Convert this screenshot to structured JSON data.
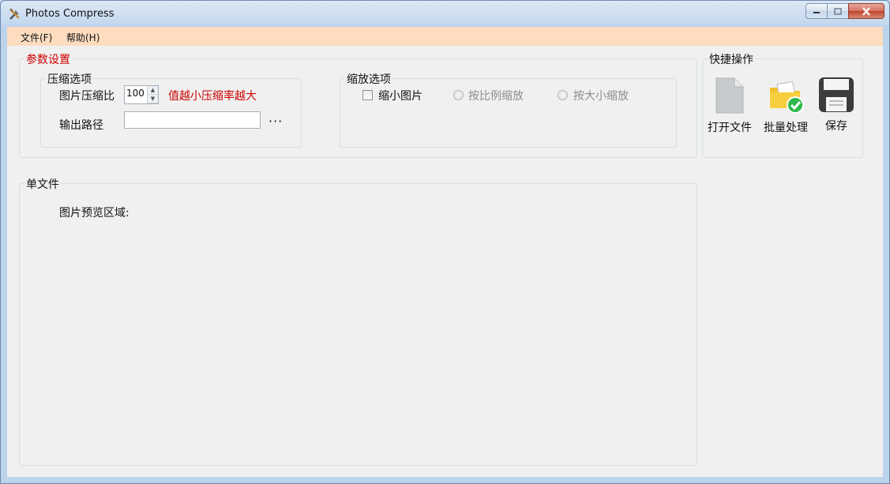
{
  "window": {
    "title": "Photos Compress",
    "app_icon": "tools-icon",
    "caption_buttons": [
      "minimize-icon",
      "maximize-icon",
      "close-icon"
    ]
  },
  "menu": {
    "items": [
      {
        "label": "文件(F)"
      },
      {
        "label": "帮助(H)"
      }
    ]
  },
  "params": {
    "group_title": "参数设置",
    "compress": {
      "group_title": "压缩选项",
      "ratio_label": "图片压缩比",
      "ratio_value": "100",
      "hint": "值越小压缩率越大",
      "output_label": "输出路径",
      "output_value": "",
      "browse_label": "···"
    },
    "scale": {
      "group_title": "缩放选项",
      "shrink_label": "缩小图片",
      "shrink_checked": false,
      "by_ratio_label": "按比例缩放",
      "by_size_label": "按大小缩放"
    }
  },
  "quick": {
    "group_title": "快捷操作",
    "buttons": [
      {
        "label": "打开文件",
        "icon": "file-icon"
      },
      {
        "label": "批量处理",
        "icon": "folder-check-icon"
      },
      {
        "label": "保存",
        "icon": "floppy-disk-icon"
      }
    ]
  },
  "single": {
    "group_title": "单文件",
    "preview_label": "图片预览区域:"
  },
  "colors": {
    "accent_red": "#cc0000",
    "menubar_bg": "#fddcbf",
    "client_bg": "#f0f0f0"
  }
}
